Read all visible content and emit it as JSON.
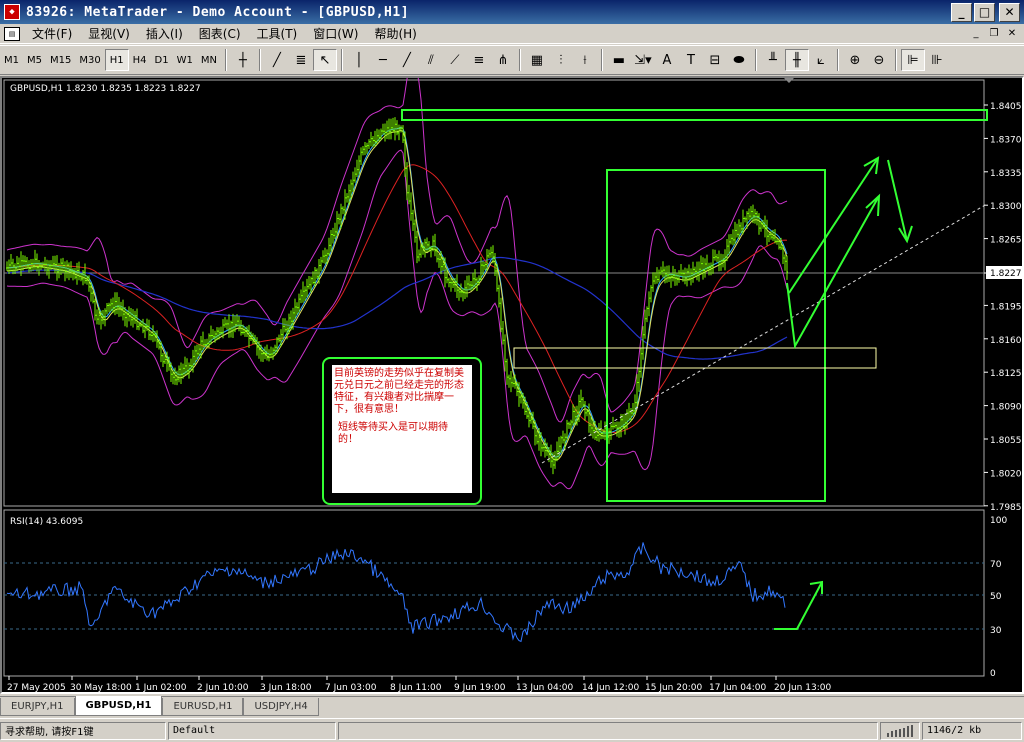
{
  "window": {
    "title": "83926: MetaTrader - Demo Account - [GBPUSD,H1]"
  },
  "menu": [
    "文件(F)",
    "显视(V)",
    "插入(I)",
    "图表(C)",
    "工具(T)",
    "窗口(W)",
    "帮助(H)"
  ],
  "toolbar": {
    "timeframes": [
      "M1",
      "M5",
      "M15",
      "M30",
      "H1",
      "H4",
      "D1",
      "W1",
      "MN"
    ],
    "active_timeframe": "H1"
  },
  "chart": {
    "header": "GBPUSD,H1  1.8230 1.8235 1.8223 1.8227",
    "price_ticks": [
      "1.8405",
      "1.8370",
      "1.8335",
      "1.8300",
      "1.8265",
      "1.8227",
      "1.8195",
      "1.8160",
      "1.8125",
      "1.8090",
      "1.8055",
      "1.8020",
      "1.7985"
    ],
    "current_price": "1.8227",
    "rsi_header": "RSI(14) 43.6095",
    "rsi_ticks": [
      "100",
      "70",
      "50",
      "30",
      "0"
    ],
    "time_labels": [
      "27 May 2005",
      "30 May 18:00",
      "1 Jun 02:00",
      "2 Jun 10:00",
      "3 Jun 18:00",
      "7 Jun 03:00",
      "8 Jun 11:00",
      "9 Jun 19:00",
      "13 Jun 04:00",
      "14 Jun 12:00",
      "15 Jun 20:00",
      "17 Jun 04:00",
      "20 Jun 13:00"
    ],
    "annotation_1": "目前英镑的走势似乎在复制美元兑日元之前已经走完的形态特征，有兴趣者对比揣摩一下，很有意思！",
    "annotation_2": "短线等待买入是可以期待的！",
    "colors": {
      "candles": "#7cfc00",
      "bollinger": "#cc33cc",
      "ma_slow": "#2233cc",
      "ma_mid": "#dd2222",
      "ma_fast": "#33aaff",
      "rsi": "#3377ff",
      "annotation_box": "#33ff33",
      "annotation_text": "#cc0000"
    }
  },
  "tabs": [
    "EURJPY,H1",
    "GBPUSD,H1",
    "EURUSD,H1",
    "USDJPY,H4"
  ],
  "active_tab": "GBPUSD,H1",
  "status": {
    "help": "寻求帮助, 请按F1键",
    "profile": "Default",
    "traffic": "1146/2 kb"
  }
}
